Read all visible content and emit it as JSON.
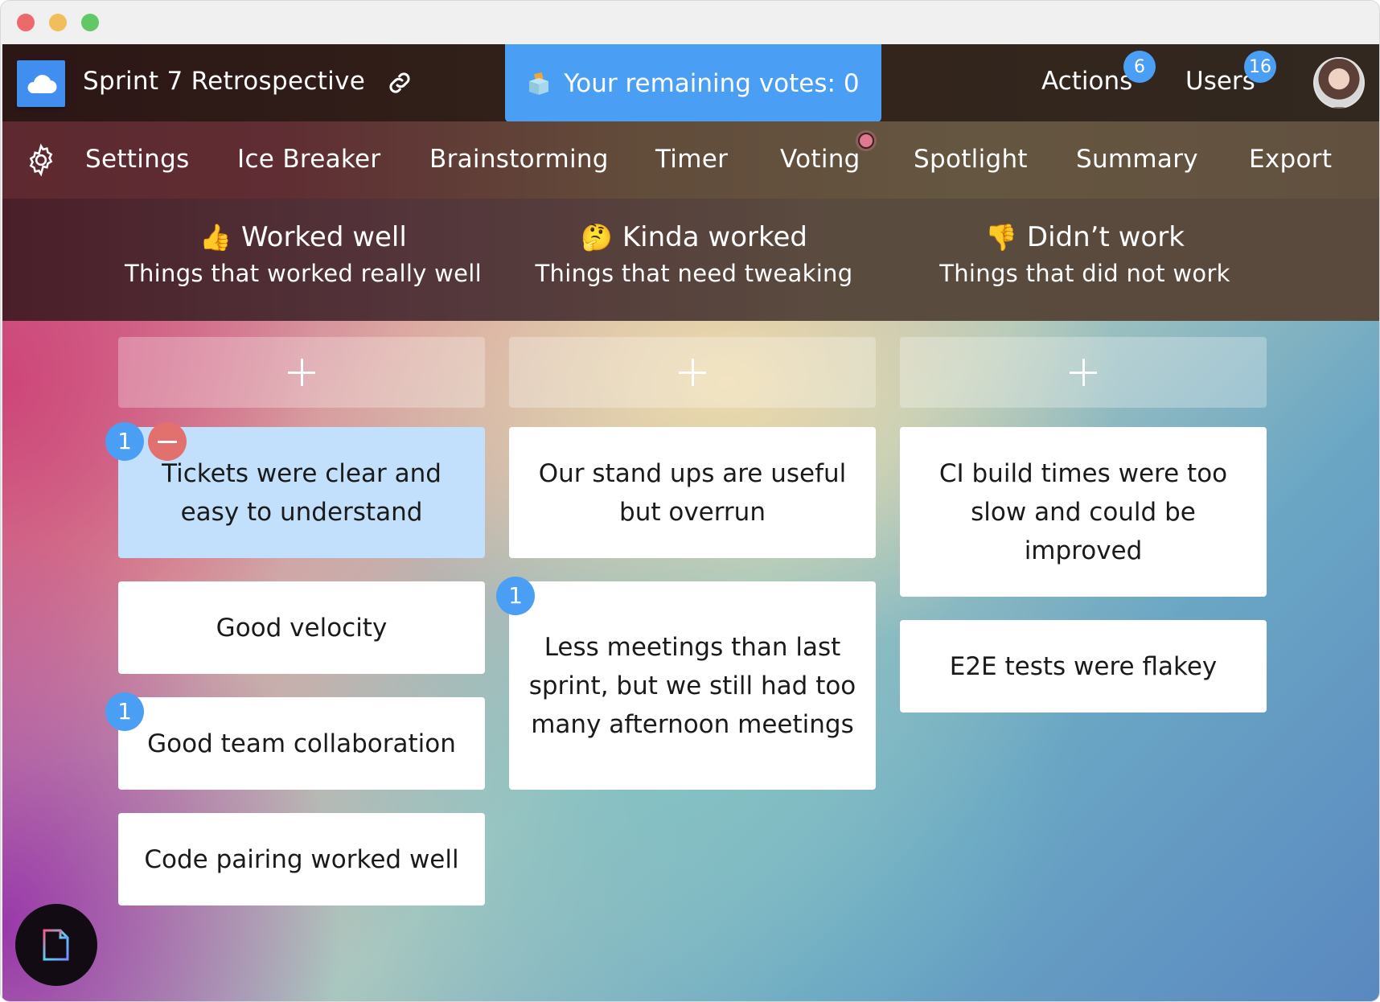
{
  "window": {
    "traffic_lights": [
      "close",
      "minimize",
      "zoom"
    ]
  },
  "header": {
    "logo_icon": "cloud-icon",
    "title": "Sprint 7 Retrospective",
    "link_icon": "link-icon",
    "votes_banner": {
      "icon": "ballot-box-icon",
      "label": "Your remaining votes: 0"
    },
    "actions": {
      "label": "Actions",
      "count": "6"
    },
    "users": {
      "label": "Users",
      "count": "16"
    },
    "avatar": "user-avatar"
  },
  "nav": {
    "settings_icon": "gear-icon",
    "items": [
      {
        "label": "Settings"
      },
      {
        "label": "Ice Breaker"
      },
      {
        "label": "Brainstorming"
      },
      {
        "label": "Timer"
      },
      {
        "label": "Voting",
        "active_indicator": true
      },
      {
        "label": "Spotlight"
      },
      {
        "label": "Summary"
      },
      {
        "label": "Export"
      }
    ]
  },
  "columns": [
    {
      "emoji": "👍",
      "emoji_name": "thumbs-up-icon",
      "title": "Worked well",
      "subtitle": "Things that worked really well",
      "add_label": "+",
      "cards": [
        {
          "text": "Tickets were clear and easy to understand",
          "votes": "1",
          "selected": true,
          "can_remove_vote": true
        },
        {
          "text": "Good velocity",
          "votes": null
        },
        {
          "text": "Good team collaboration",
          "votes": "1"
        },
        {
          "text": "Code pairing worked well",
          "votes": null
        }
      ]
    },
    {
      "emoji": "🤔",
      "emoji_name": "thinking-face-icon",
      "title": "Kinda worked",
      "subtitle": "Things that need tweaking",
      "add_label": "+",
      "cards": [
        {
          "text": "Our stand ups are useful but overrun",
          "votes": null
        },
        {
          "text": "Less meetings than last sprint, but we still had too many afternoon meetings",
          "votes": "1"
        }
      ]
    },
    {
      "emoji": "👎",
      "emoji_name": "thumbs-down-icon",
      "title": "Didn’t work",
      "subtitle": "Things that did not work",
      "add_label": "+",
      "cards": [
        {
          "text": "CI build times were too slow and could be improved",
          "votes": null
        },
        {
          "text": "E2E tests were flakey",
          "votes": null
        }
      ]
    }
  ],
  "colors": {
    "accent_blue": "#4a9ff5",
    "remove_red": "#e2706e",
    "selected_card": "#c2e0fb",
    "voting_dot": "#e07890"
  },
  "floating_button": {
    "icon": "document-icon"
  }
}
